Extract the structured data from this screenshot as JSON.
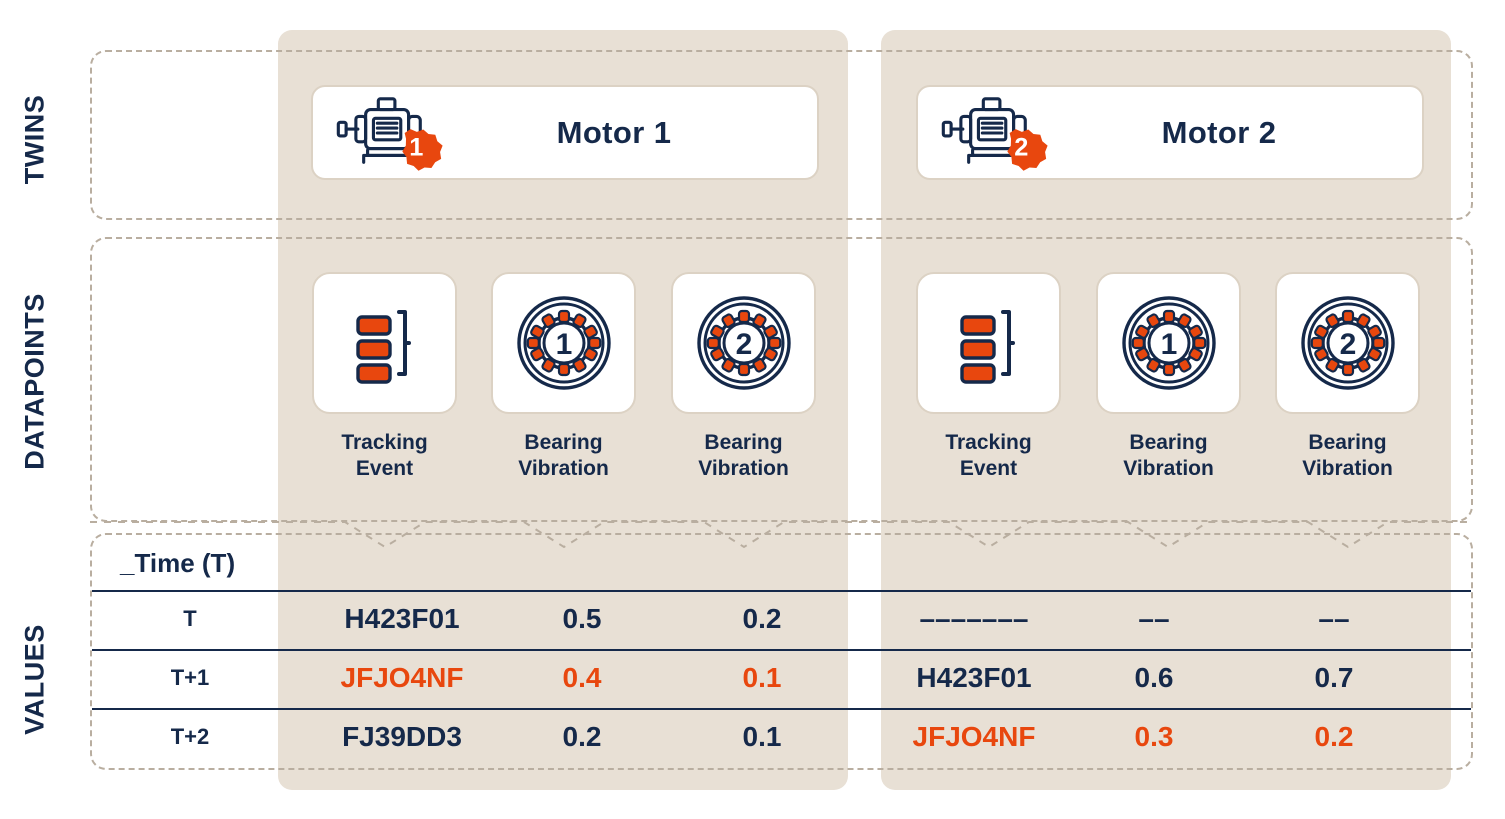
{
  "sections": {
    "twins_label": "TWINS",
    "datapoints_label": "DATAPOINTS",
    "values_label": "VALUES"
  },
  "colors": {
    "ink": "#15294A",
    "accent": "#E8470E",
    "band": "#E8E0D5",
    "dash": "#b9aea0",
    "card_border": "#DCD2C4",
    "page": "#FFFFFF"
  },
  "twins": [
    {
      "badge": "1",
      "title": "Motor 1",
      "icon": "motor-icon"
    },
    {
      "badge": "2",
      "title": "Motor 2",
      "icon": "motor-icon"
    }
  ],
  "datapoints": [
    [
      {
        "icon": "tracking-event-icon",
        "label": "Tracking\nEvent",
        "line1": "Tracking",
        "line2": "Event"
      },
      {
        "icon": "bearing-icon",
        "badge": "1",
        "label": "Bearing\nVibration",
        "line1": "Bearing",
        "line2": "Vibration"
      },
      {
        "icon": "bearing-icon",
        "badge": "2",
        "label": "Bearing\nVibration",
        "line1": "Bearing",
        "line2": "Vibration"
      }
    ],
    [
      {
        "icon": "tracking-event-icon",
        "label": "Tracking\nEvent",
        "line1": "Tracking",
        "line2": "Event"
      },
      {
        "icon": "bearing-icon",
        "badge": "1",
        "label": "Bearing\nVibration",
        "line1": "Bearing",
        "line2": "Vibration"
      },
      {
        "icon": "bearing-icon",
        "badge": "2",
        "label": "Bearing\nVibration",
        "line1": "Bearing",
        "line2": "Vibration"
      }
    ]
  ],
  "values": {
    "time_header": "_Time (T)",
    "rows": [
      {
        "time": "T",
        "motor1": {
          "id": "H423F01",
          "v1": "0.5",
          "v2": "0.2",
          "alert": false
        },
        "motor2": {
          "id": "–––––––",
          "v1": "––",
          "v2": "––",
          "alert": false
        }
      },
      {
        "time": "T+1",
        "motor1": {
          "id": "JFJO4NF",
          "v1": "0.4",
          "v2": "0.1",
          "alert": true
        },
        "motor2": {
          "id": "H423F01",
          "v1": "0.6",
          "v2": "0.7",
          "alert": false
        }
      },
      {
        "time": "T+2",
        "motor1": {
          "id": "FJ39DD3",
          "v1": "0.2",
          "v2": "0.1",
          "alert": false
        },
        "motor2": {
          "id": "JFJO4NF",
          "v1": "0.3",
          "v2": "0.2",
          "alert": true
        }
      }
    ]
  }
}
